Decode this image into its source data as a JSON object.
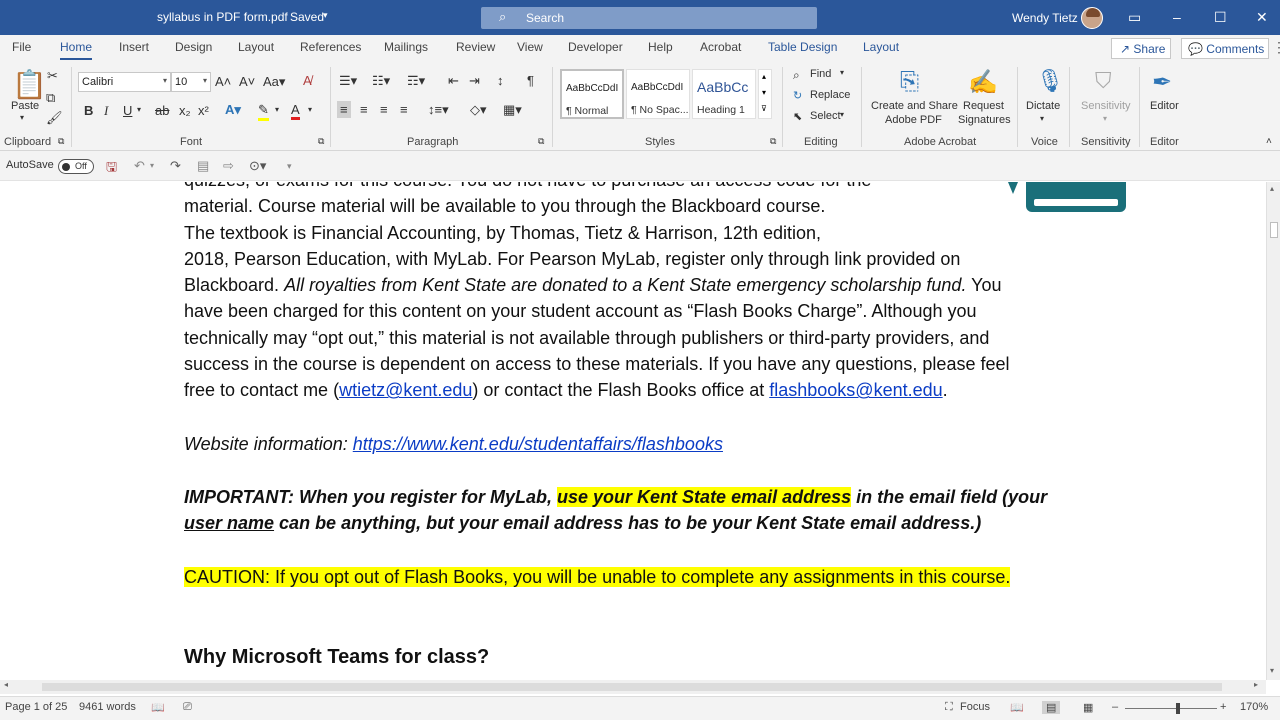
{
  "titlebar": {
    "doc_title": "syllabus in PDF form.pdf",
    "saved": "Saved",
    "search_placeholder": "Search",
    "user_name": "Wendy Tietz"
  },
  "tabs": [
    "File",
    "Home",
    "Insert",
    "Design",
    "Layout",
    "References",
    "Mailings",
    "Review",
    "View",
    "Developer",
    "Help",
    "Acrobat",
    "Table Design",
    "Layout"
  ],
  "active_tab": "Home",
  "share_label": "Share",
  "comments_label": "Comments",
  "ribbon": {
    "clipboard": {
      "paste": "Paste",
      "label": "Clipboard"
    },
    "font": {
      "name": "Calibri",
      "size": "10",
      "label": "Font"
    },
    "paragraph": {
      "label": "Paragraph"
    },
    "styles": {
      "items": [
        {
          "preview": "AaBbCcDdI",
          "name": "¶ Normal"
        },
        {
          "preview": "AaBbCcDdI",
          "name": "¶ No Spac..."
        },
        {
          "preview": "AaBbCc",
          "name": "Heading 1"
        }
      ],
      "label": "Styles"
    },
    "editing": {
      "find": "Find",
      "replace": "Replace",
      "select": "Select",
      "label": "Editing"
    },
    "acrobat": {
      "create_share_1": "Create and Share",
      "create_share_2": "Adobe PDF",
      "request_1": "Request",
      "request_2": "Signatures",
      "label": "Adobe Acrobat"
    },
    "voice": {
      "dictate": "Dictate",
      "label": "Voice"
    },
    "sensitivity": {
      "btn": "Sensitivity",
      "label": "Sensitivity"
    },
    "editor": {
      "btn": "Editor",
      "label": "Editor"
    }
  },
  "qat": {
    "autosave": "AutoSave",
    "toggle": "Off"
  },
  "document": {
    "line1": "quizzes, or exams for this course.  You do not have to purchase an access code for the",
    "line2": "material.  Course material will be available to you through the Blackboard course.",
    "line3": "The textbook is Financial Accounting, by Thomas, Tietz & Harrison, 12th edition,",
    "line4": "2018, Pearson Education, with MyLab. For Pearson MyLab, register only through link provided on",
    "line5_a": "Blackboard. ",
    "line5_b": "All royalties from Kent State are donated to a Kent State emergency scholarship fund.",
    "line5_c": " You",
    "line6": "have been charged for this content on your student account as “Flash Books Charge”.   Although you",
    "line7": "technically may “opt out,” this material is not available through publishers or third-party providers, and",
    "line8": "success in the course is dependent on access to these materials. If you have any questions, please feel",
    "line9_a": "free to contact me (",
    "email1": "wtietz@kent.edu",
    "line9_b": ") or contact the Flash Books office at ",
    "email2": "flashbooks@kent.edu",
    "line9_c": ".",
    "website_label": "Website information:  ",
    "website_url": "https://www.kent.edu/studentaffairs/flashbooks",
    "imp_a": "IMPORTANT: When you register for MyLab, ",
    "imp_hl": "use your Kent State email address",
    "imp_b": " in the email field (your",
    "imp_user": "user name",
    "imp_c": " can be anything, but your email address has to be your Kent State email address.)",
    "caution": "CAUTION: If you opt out of Flash Books, you will be unable to complete any assignments in this course.",
    "heading": "Why Microsoft Teams for class?"
  },
  "status": {
    "page": "Page 1 of 25",
    "words": "9461 words",
    "focus": "Focus",
    "zoom": "170%"
  },
  "colors": {
    "accent": "#2b579a",
    "highlight": "#ffff00",
    "link": "#0b3cc5"
  }
}
